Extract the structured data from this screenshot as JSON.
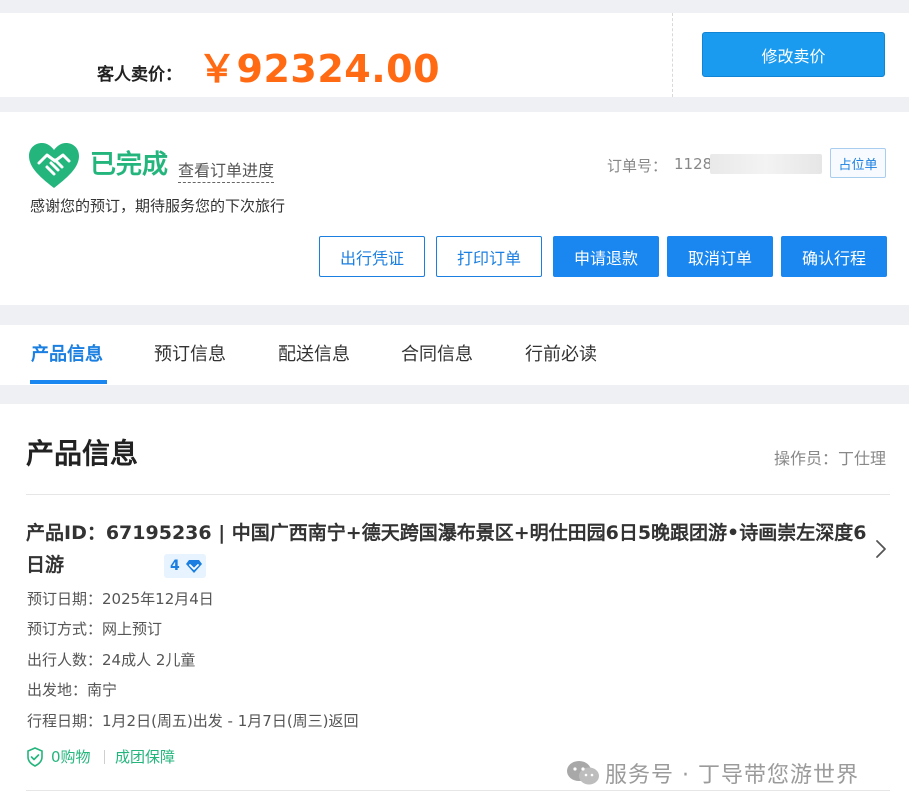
{
  "price": {
    "label": "客人卖价：",
    "value": "￥92324.00",
    "modify_button": "修改卖价"
  },
  "status": {
    "title": "已完成",
    "progress_link": "查看订单进度",
    "thanks": "感谢您的预订，期待服务您的下次旅行",
    "order_no_label": "订单号：",
    "order_no_visible": "1128",
    "placeholder_button": "占位单",
    "actions": {
      "voucher": "出行凭证",
      "print": "打印订单",
      "refund": "申请退款",
      "cancel": "取消订单",
      "confirm": "确认行程"
    }
  },
  "tabs": [
    {
      "label": "产品信息",
      "active": true
    },
    {
      "label": "预订信息",
      "active": false
    },
    {
      "label": "配送信息",
      "active": false
    },
    {
      "label": "合同信息",
      "active": false
    },
    {
      "label": "行前必读",
      "active": false
    }
  ],
  "product": {
    "section_title": "产品信息",
    "operator": "操作员：丁仕理",
    "title": "产品ID：67195236 | 中国广西南宁+德天跨国瀑布景区+明仕田园6日5晚跟团游•诗画崇左深度6日游",
    "badge": "4",
    "rows": [
      "预订日期：2025年12月4日",
      "预订方式：网上预订",
      "出行人数：24成人 2儿童",
      "出发地：南宁",
      "行程日期：1月2日(周五)出发 - 1月7日(周三)返回"
    ],
    "guarantees": [
      "0购物",
      "成团保障"
    ]
  },
  "watermark": "服务号 · 丁导带您游世界",
  "colors": {
    "accent_blue": "#1a86ef",
    "price_orange": "#ff6a13",
    "status_green": "#24b57d"
  },
  "icons": {
    "status": "heart-handshake-icon",
    "badge": "diamond-icon",
    "chevron": "chevron-right-icon",
    "guarantee": "shield-check-icon",
    "watermark": "wechat-icon"
  }
}
